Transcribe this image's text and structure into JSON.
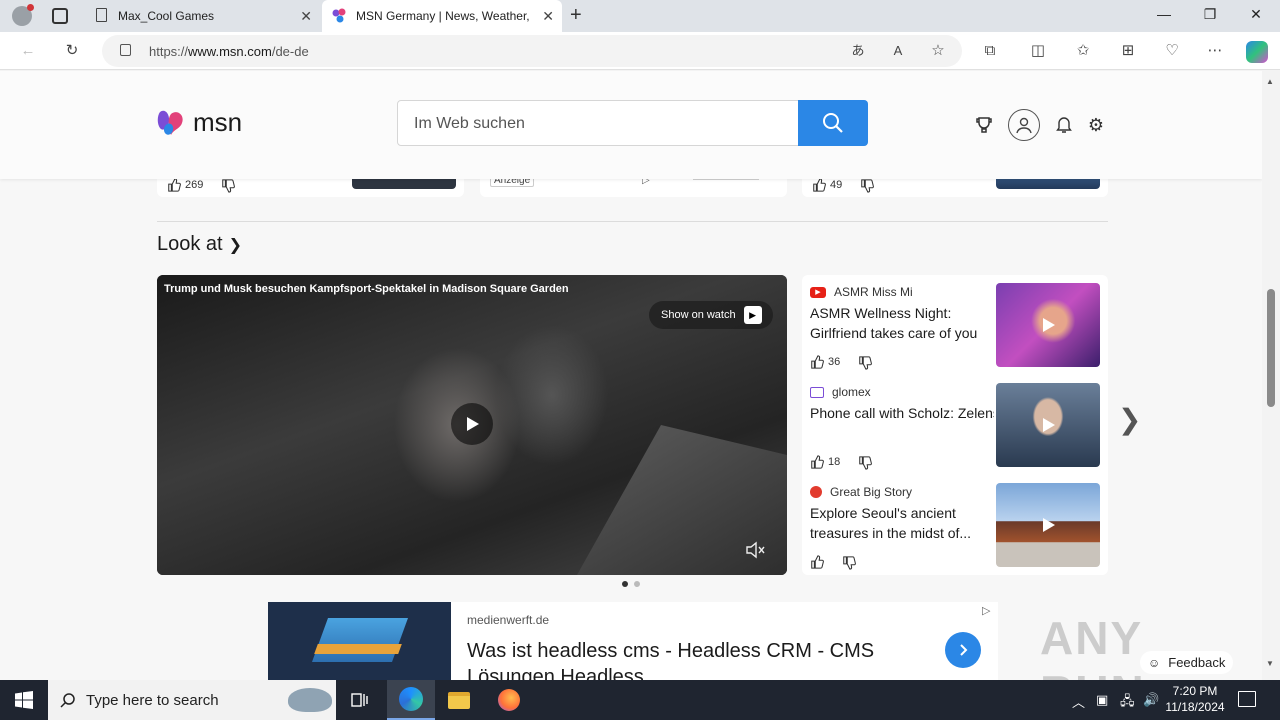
{
  "browser": {
    "tabs": [
      {
        "title": "Max_Cool Games"
      },
      {
        "title": "MSN Germany | News, Weather, Sp"
      }
    ],
    "url_prefix": "https://",
    "url_host": "www.msn.com",
    "url_path": "/de-de"
  },
  "header": {
    "logo_text": "msn",
    "search_placeholder": "Im Web suchen"
  },
  "prev_cards": [
    {
      "likes": "269"
    },
    {
      "ad_label": "Anzeige"
    },
    {
      "likes": "49"
    }
  ],
  "section": {
    "title": "Look at",
    "video": {
      "caption": "Trump und Musk besuchen Kampfsport-Spektakel in Madison Square Garden",
      "watch_label": "Show on watch"
    },
    "items": [
      {
        "source": "ASMR Miss Mi",
        "headline": "ASMR Wellness Night: Girlfriend takes care of you",
        "likes": "36"
      },
      {
        "source": "glomex",
        "headline": "Phone call with Scholz: Zelensky hopes for German...",
        "likes": "18"
      },
      {
        "source": "Great Big Story",
        "headline": "Explore Seoul's ancient treasures in the midst of...",
        "likes": ""
      }
    ]
  },
  "ad": {
    "domain": "medienwerft.de",
    "title": "Was ist headless cms - Headless CRM - CMS Lösungen Headless"
  },
  "watermark": "ANY RUN",
  "feedback_label": "Feedback",
  "taskbar": {
    "search_placeholder": "Type here to search",
    "time": "7:20 PM",
    "date": "11/18/2024"
  },
  "colors": {
    "accent": "#2b87e6",
    "taskbar": "#1f2530"
  }
}
